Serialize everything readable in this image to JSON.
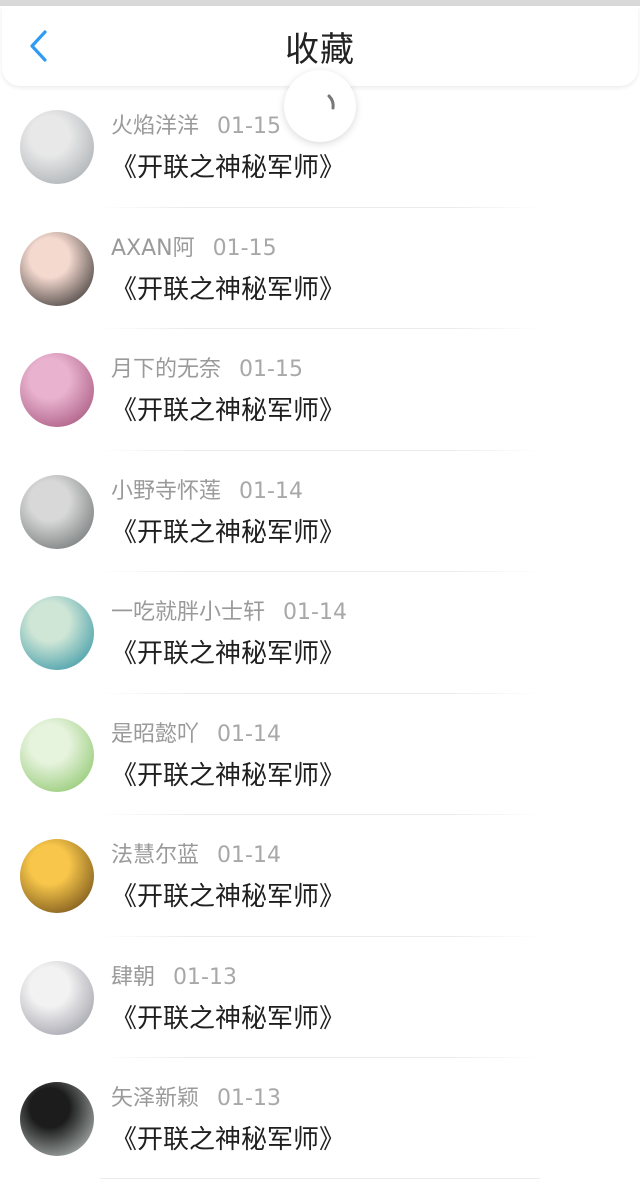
{
  "header": {
    "title": "收藏",
    "back_icon": "chevron-left-icon",
    "accent_color": "#2f9bf2"
  },
  "items": [
    {
      "username": "火焰洋洋",
      "date": "01-15",
      "book": "《开联之神秘军师》",
      "avatar_colors": [
        "#e8e8e8",
        "#9da3a8"
      ]
    },
    {
      "username": "AXAN阿",
      "date": "01-15",
      "book": "《开联之神秘军师》",
      "avatar_colors": [
        "#f4d9cf",
        "#1c1c1c"
      ]
    },
    {
      "username": "月下的无奈",
      "date": "01-15",
      "book": "《开联之神秘军师》",
      "avatar_colors": [
        "#e9b3cf",
        "#9b4670"
      ]
    },
    {
      "username": "小野寺怀莲",
      "date": "01-14",
      "book": "《开联之神秘军师》",
      "avatar_colors": [
        "#d8d8d8",
        "#5f6464"
      ]
    },
    {
      "username": "一吃就胖小士轩",
      "date": "01-14",
      "book": "《开联之神秘军师》",
      "avatar_colors": [
        "#cfe6d6",
        "#1f8a9e"
      ]
    },
    {
      "username": "是昭懿吖",
      "date": "01-14",
      "book": "《开联之神秘军师》",
      "avatar_colors": [
        "#e6f3dd",
        "#7fbf5a"
      ]
    },
    {
      "username": "法慧尔蓝",
      "date": "01-14",
      "book": "《开联之神秘军师》",
      "avatar_colors": [
        "#f7c64a",
        "#5a3a10"
      ]
    },
    {
      "username": "肆朝",
      "date": "01-13",
      "book": "《开联之神秘军师》",
      "avatar_colors": [
        "#f2f2f2",
        "#8e8e9a"
      ]
    },
    {
      "username": "矢泽新颖",
      "date": "01-13",
      "book": "《开联之神秘军师》",
      "avatar_colors": [
        "#1c1c1c",
        "#cfd8d4"
      ]
    }
  ]
}
